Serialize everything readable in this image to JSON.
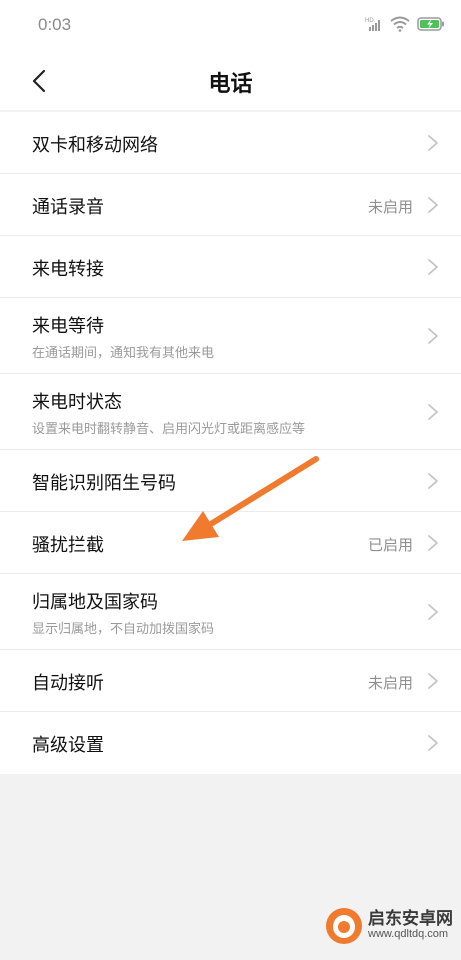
{
  "status_bar": {
    "time": "0:03",
    "icons": [
      "hd-signal-icon",
      "wifi-icon",
      "battery-charging-icon"
    ]
  },
  "header": {
    "title": "电话",
    "back_icon": "back-arrow-icon"
  },
  "settings": [
    {
      "title": "双卡和移动网络",
      "subtitle": "",
      "status": ""
    },
    {
      "title": "通话录音",
      "subtitle": "",
      "status": "未启用"
    },
    {
      "title": "来电转接",
      "subtitle": "",
      "status": ""
    },
    {
      "title": "来电等待",
      "subtitle": "在通话期间，通知我有其他来电",
      "status": ""
    },
    {
      "title": "来电时状态",
      "subtitle": "设置来电时翻转静音、启用闪光灯或距离感应等",
      "status": ""
    },
    {
      "title": "智能识别陌生号码",
      "subtitle": "",
      "status": ""
    },
    {
      "title": "骚扰拦截",
      "subtitle": "",
      "status": "已启用"
    },
    {
      "title": "归属地及国家码",
      "subtitle": "显示归属地，不自动加拨国家码",
      "status": ""
    },
    {
      "title": "自动接听",
      "subtitle": "",
      "status": "未启用"
    },
    {
      "title": "高级设置",
      "subtitle": "",
      "status": ""
    }
  ],
  "colors": {
    "background": "#f2f2f2",
    "surface": "#ffffff",
    "annotation_arrow": "#f07a2e",
    "secondary_text": "#9a9a9a"
  },
  "watermark": {
    "name": "启东安卓网",
    "url": "www.qdltdq.com"
  }
}
